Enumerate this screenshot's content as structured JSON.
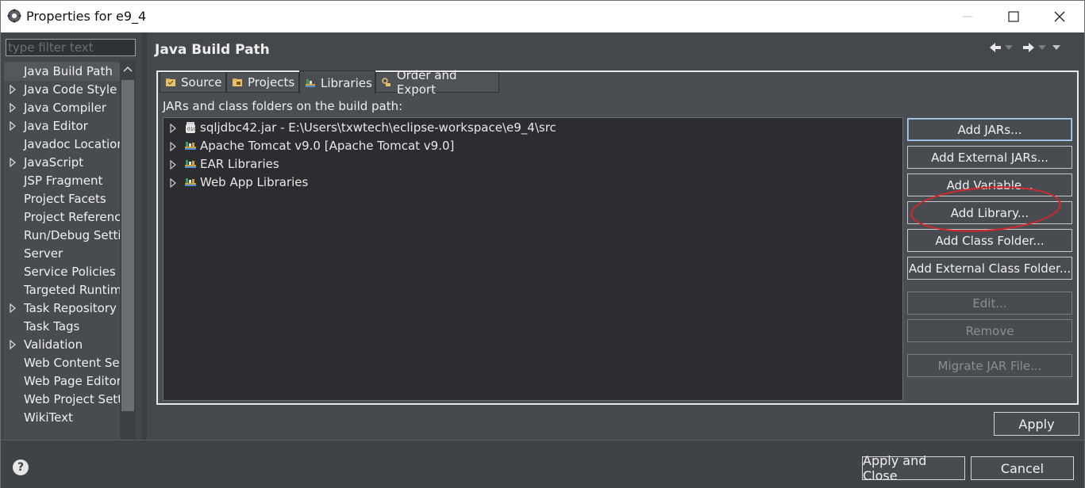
{
  "window": {
    "title": "Properties for e9_4",
    "icons": [
      "gear-app-icon",
      "minimize-icon",
      "maximize-icon",
      "close-icon"
    ]
  },
  "sidebar": {
    "filter_placeholder": "type filter text",
    "items": [
      {
        "label": "Java Build Path",
        "expandable": false,
        "selected": true
      },
      {
        "label": "Java Code Style",
        "expandable": true
      },
      {
        "label": "Java Compiler",
        "expandable": true
      },
      {
        "label": "Java Editor",
        "expandable": true
      },
      {
        "label": "Javadoc Location",
        "expandable": false
      },
      {
        "label": "JavaScript",
        "expandable": true
      },
      {
        "label": "JSP Fragment",
        "expandable": false
      },
      {
        "label": "Project Facets",
        "expandable": false
      },
      {
        "label": "Project References",
        "expandable": false
      },
      {
        "label": "Run/Debug Settings",
        "expandable": false
      },
      {
        "label": "Server",
        "expandable": false
      },
      {
        "label": "Service Policies",
        "expandable": false
      },
      {
        "label": "Targeted Runtimes",
        "expandable": false
      },
      {
        "label": "Task Repository",
        "expandable": true
      },
      {
        "label": "Task Tags",
        "expandable": false
      },
      {
        "label": "Validation",
        "expandable": true
      },
      {
        "label": "Web Content Settings",
        "expandable": false
      },
      {
        "label": "Web Page Editor",
        "expandable": false
      },
      {
        "label": "Web Project Settings",
        "expandable": false
      },
      {
        "label": "WikiText",
        "expandable": false
      }
    ]
  },
  "main": {
    "title": "Java Build Path",
    "tabs": [
      {
        "label": "Source",
        "icon": "source-folder-icon"
      },
      {
        "label": "Projects",
        "icon": "projects-icon"
      },
      {
        "label": "Libraries",
        "icon": "libraries-icon",
        "active": true
      },
      {
        "label": "Order and Export",
        "icon": "order-export-icon"
      }
    ],
    "caption": "JARs and class folders on the build path:",
    "libraries": [
      {
        "label": "sqljdbc42.jar - E:\\Users\\txwtech\\eclipse-workspace\\e9_4\\src",
        "icon": "jar-icon"
      },
      {
        "label": "Apache Tomcat v9.0 [Apache Tomcat v9.0]",
        "icon": "library-icon"
      },
      {
        "label": "EAR Libraries",
        "icon": "library-icon"
      },
      {
        "label": "Web App Libraries",
        "icon": "library-icon"
      }
    ],
    "buttons": {
      "add_jars": "Add JARs...",
      "add_external_jars": "Add External JARs...",
      "add_variable": "Add Variable...",
      "add_library": "Add Library...",
      "add_class_folder": "Add Class Folder...",
      "add_external_class_folder": "Add External Class Folder...",
      "edit": "Edit...",
      "remove": "Remove",
      "migrate_jar": "Migrate JAR File..."
    },
    "apply": "Apply"
  },
  "footer": {
    "help": "?",
    "apply_and_close": "Apply and Close",
    "cancel": "Cancel"
  },
  "colors": {
    "highlight": "#d8262a",
    "background": "#44484c"
  }
}
